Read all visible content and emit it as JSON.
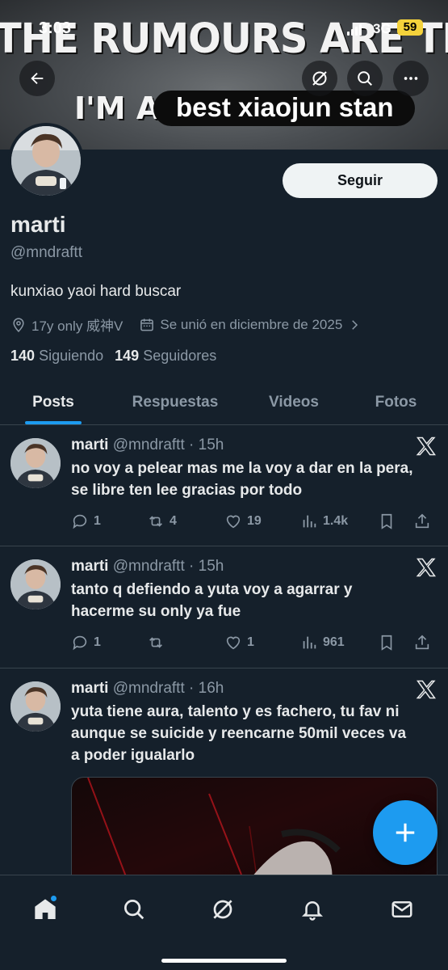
{
  "status": {
    "time": "3:03",
    "network": "3G",
    "battery": "59"
  },
  "banner": {
    "headline": "THE RUMOURS ARE TRUE",
    "prefix": "I'M A",
    "sticker": "best xiaojun stan"
  },
  "profile": {
    "name": "marti",
    "handle": "@mndraftt",
    "bio": "kunxiao yaoi hard buscar",
    "location": "17y only 威神V",
    "joined": "Se unió en diciembre de 2025",
    "following_count": "140",
    "following_label": "Siguiendo",
    "followers_count": "149",
    "followers_label": "Seguidores",
    "follow_button": "Seguir"
  },
  "tabs": [
    {
      "label": "Posts",
      "active": true
    },
    {
      "label": "Respuestas",
      "active": false
    },
    {
      "label": "Videos",
      "active": false
    },
    {
      "label": "Fotos",
      "active": false
    }
  ],
  "posts": [
    {
      "name": "marti",
      "handle": "@mndraftt",
      "time": "15h",
      "text": "no voy a pelear mas me la voy a dar en la pera, se libre ten lee gracias por todo",
      "replies": "1",
      "reposts": "4",
      "likes": "19",
      "views": "1.4k"
    },
    {
      "name": "marti",
      "handle": "@mndraftt",
      "time": "15h",
      "text": "tanto q defiendo a yuta voy a agarrar y hacerme su only ya fue",
      "replies": "1",
      "reposts": "",
      "likes": "1",
      "views": "961"
    },
    {
      "name": "marti",
      "handle": "@mndraftt",
      "time": "16h",
      "text": "yuta tiene aura, talento y es fachero, tu fav ni aunque se suicide y reencarne 50mil veces va a poder igualarlo"
    }
  ],
  "colors": {
    "background": "#15202b",
    "accent": "#1d9bf0",
    "muted": "#8b98a5",
    "text": "#e7e9ea"
  },
  "nav": [
    "home-icon",
    "search-icon",
    "grok-icon",
    "notifications-icon",
    "messages-icon"
  ]
}
